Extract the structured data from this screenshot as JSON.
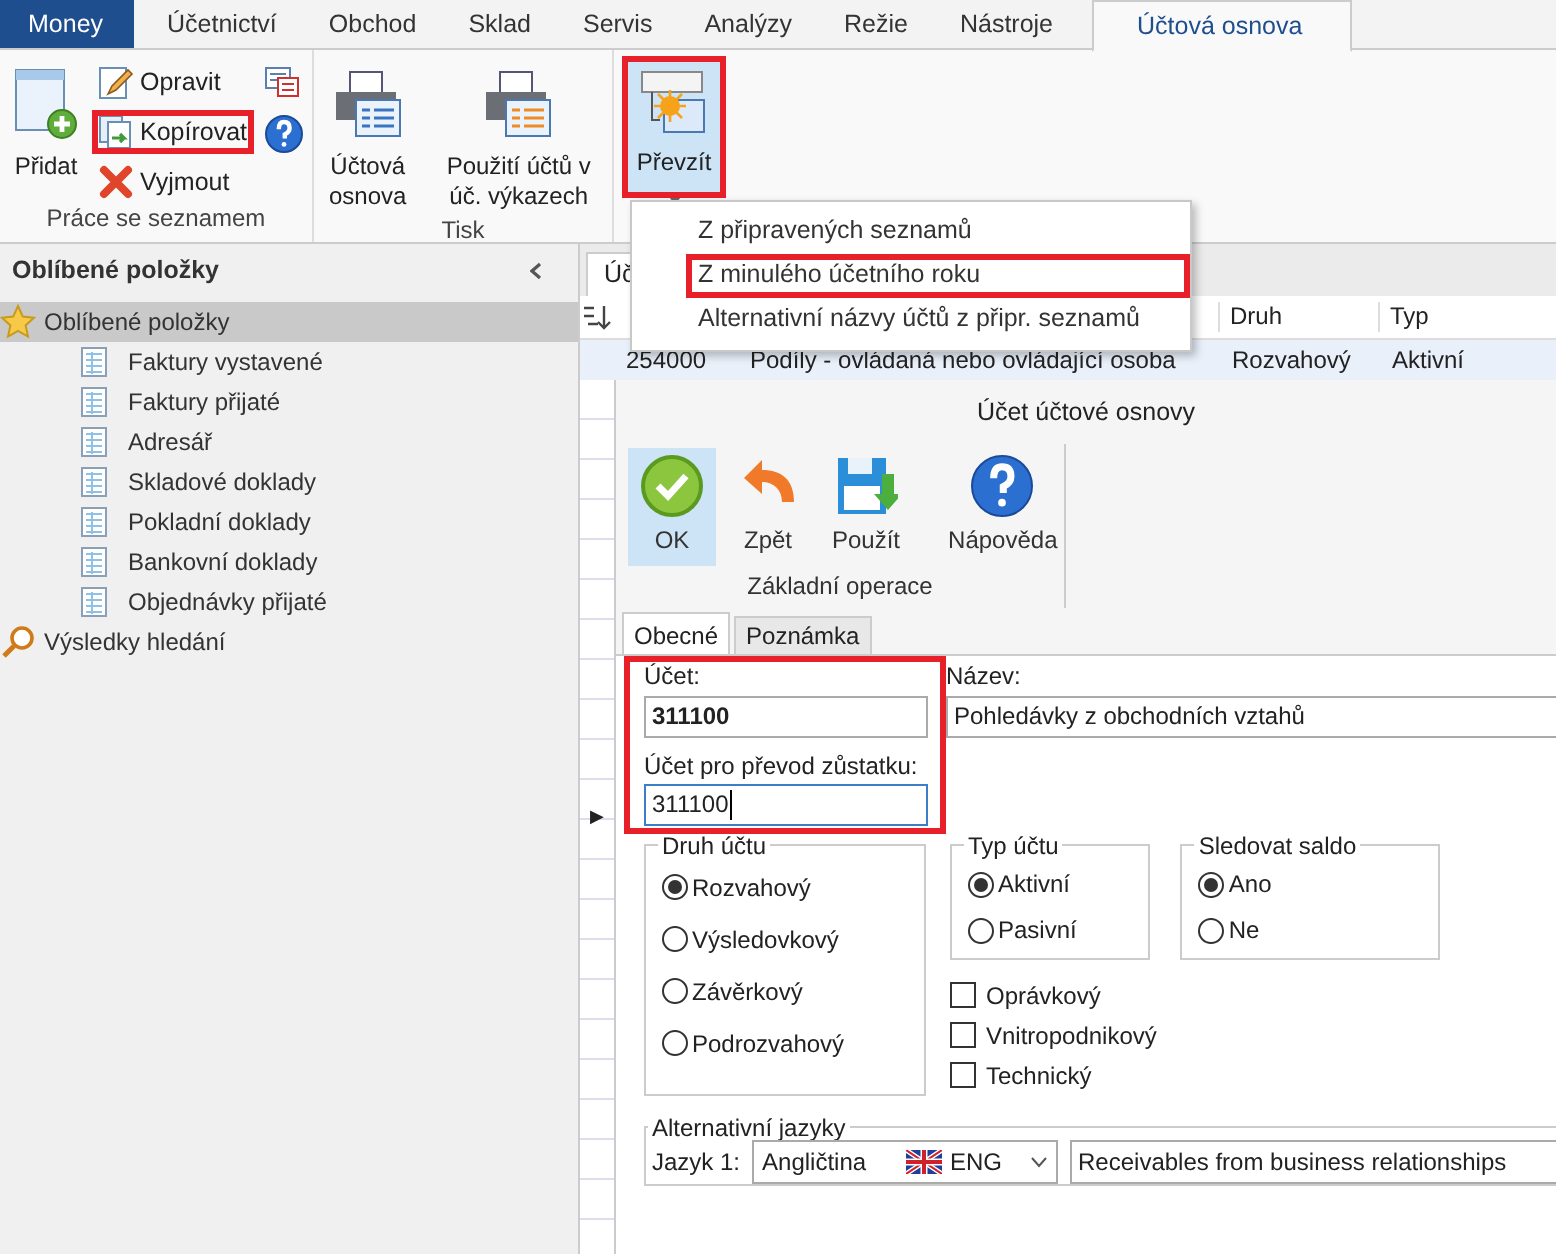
{
  "app_tabs": [
    {
      "label": "Money",
      "kind": "app",
      "selected": false
    },
    {
      "label": "Účetnictví",
      "kind": "tab",
      "selected": false
    },
    {
      "label": "Obchod",
      "kind": "tab",
      "selected": false
    },
    {
      "label": "Sklad",
      "kind": "tab",
      "selected": false
    },
    {
      "label": "Servis",
      "kind": "tab",
      "selected": false
    },
    {
      "label": "Analýzy",
      "kind": "tab",
      "selected": false
    },
    {
      "label": "Režie",
      "kind": "tab",
      "selected": false
    },
    {
      "label": "Nástroje",
      "kind": "tab",
      "selected": false
    },
    {
      "label": "Účtová osnova",
      "kind": "tab",
      "selected": true
    }
  ],
  "ribbon": {
    "groups": [
      {
        "label": "Práce se seznamem",
        "buttons": [
          {
            "kind": "large",
            "label": "Přidat",
            "selected": false,
            "highlighted": false
          },
          {
            "kind": "small",
            "label": "Opravit",
            "selected": false,
            "highlighted": false
          },
          {
            "kind": "small",
            "label": "Kopírovat",
            "selected": false,
            "highlighted": true
          },
          {
            "kind": "small",
            "label": "Vyjmout",
            "selected": false,
            "highlighted": false
          },
          {
            "kind": "icon",
            "selected": false,
            "highlighted": false
          },
          {
            "kind": "icon",
            "selected": false,
            "highlighted": false
          }
        ]
      },
      {
        "label": "Tisk",
        "buttons": [
          {
            "kind": "large",
            "label": "Účtová osnova",
            "selected": false,
            "highlighted": false
          },
          {
            "kind": "large",
            "label": "Použití účtů v úč. výkazech",
            "selected": false,
            "highlighted": false
          }
        ]
      },
      {
        "buttons": [
          {
            "kind": "dropdown",
            "label": "Převzít",
            "selected": true,
            "highlighted": true
          }
        ]
      }
    ]
  },
  "dropdown_menu": [
    {
      "label": "Z připravených seznamů",
      "highlighted": false
    },
    {
      "label": "Z minulého účetního roku",
      "highlighted": true
    },
    {
      "label": "Alternativní názvy účtů z připr. seznamů",
      "highlighted": false
    }
  ],
  "sidebar": {
    "title": "Oblíbené položky",
    "items": [
      {
        "label": "Oblíbené položky",
        "selected": true,
        "children": [
          {
            "label": "Faktury vystavené",
            "selected": false
          },
          {
            "label": "Faktury přijaté",
            "selected": false
          },
          {
            "label": "Adresář",
            "selected": false
          },
          {
            "label": "Skladové doklady",
            "selected": false
          },
          {
            "label": "Pokladní doklady",
            "selected": false
          },
          {
            "label": "Bankovní doklady",
            "selected": false
          },
          {
            "label": "Objednávky přijaté",
            "selected": false
          }
        ]
      },
      {
        "label": "Výsledky hledání",
        "selected": false
      }
    ]
  },
  "table": {
    "tab": "Úč",
    "columns": [
      "",
      "",
      "Druh",
      "Typ"
    ],
    "rows": [
      {
        "cells": [
          "254000",
          "Podíly - ovládaná nebo ovládající osoba",
          "Rozvahový",
          "Aktivní"
        ],
        "selected": true
      }
    ],
    "row_indicator": "▶"
  },
  "dialog": {
    "title": "Účet účtové osnovy",
    "toolbar": {
      "buttons": [
        {
          "label": "OK",
          "selected": true
        },
        {
          "label": "Zpět",
          "selected": false
        },
        {
          "label": "Použít",
          "selected": false
        },
        {
          "label": "Nápověda",
          "selected": false
        }
      ],
      "group_label": "Základní operace"
    },
    "tabs": [
      {
        "label": "Obecné",
        "selected": true
      },
      {
        "label": "Poznámka",
        "selected": false
      }
    ],
    "account_block": {
      "highlighted": true,
      "account": {
        "label": "Účet:",
        "value": "311100"
      },
      "transfer_account": {
        "label": "Účet pro převod zůstatku:",
        "value": "311100",
        "focused": true
      }
    },
    "name": {
      "label": "Název:",
      "value": "Pohledávky z obchodních vztahů"
    },
    "radio_groups": [
      {
        "title": "Druh účtu",
        "options": [
          {
            "label": "Rozvahový",
            "selected": true
          },
          {
            "label": "Výsledovkový",
            "selected": false
          },
          {
            "label": "Závěrkový",
            "selected": false
          },
          {
            "label": "Podrozvahový",
            "selected": false
          }
        ]
      },
      {
        "title": "Typ účtu",
        "options": [
          {
            "label": "Aktivní",
            "selected": true
          },
          {
            "label": "Pasivní",
            "selected": false
          }
        ]
      },
      {
        "title": "Sledovat saldo",
        "options": [
          {
            "label": "Ano",
            "selected": true
          },
          {
            "label": "Ne",
            "selected": false
          }
        ]
      }
    ],
    "checkboxes": [
      {
        "label": "Oprávkový",
        "checked": false
      },
      {
        "label": "Vnitropodnikový",
        "checked": false
      },
      {
        "label": "Technický",
        "checked": false
      }
    ],
    "alternative_languages": {
      "title": "Alternativní jazyky",
      "rows": [
        {
          "label": "Jazyk 1:",
          "language": "Angličtina",
          "code": "ENG",
          "value": "Receivables from business relationships"
        }
      ]
    }
  }
}
